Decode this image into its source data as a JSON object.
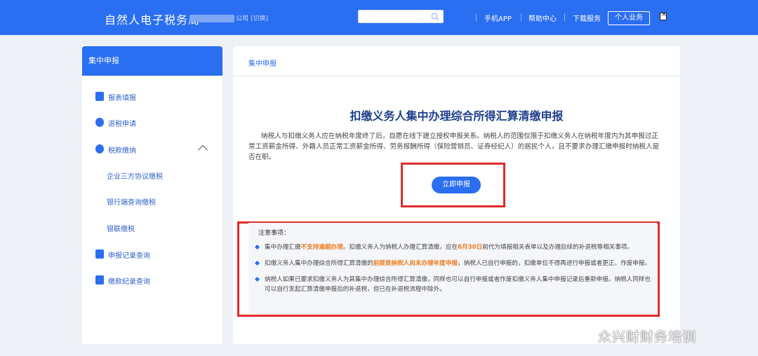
{
  "header": {
    "brand": "自然人电子税务局",
    "company_suffix": "公司",
    "switch_label": "[切换]",
    "nav": [
      "手机APP",
      "帮助中心",
      "下载服务"
    ],
    "personal_button": "个人业务"
  },
  "sidebar": {
    "heading": "集中申报",
    "items": [
      {
        "label": "报表填报",
        "icon": "form-icon"
      },
      {
        "label": "退税申请",
        "icon": "refund-icon"
      },
      {
        "label": "税款缴纳",
        "icon": "payment-icon"
      },
      {
        "label": "申报记录查询",
        "icon": "record-search-icon"
      },
      {
        "label": "缴款纪录查询",
        "icon": "payment-record-icon"
      }
    ],
    "subitems": [
      "企业三方协议缴税",
      "银行端查询缴税",
      "银联缴税"
    ]
  },
  "main": {
    "breadcrumb": "集中申报",
    "title": "扣缴义务人集中办理综合所得汇算清缴申报",
    "intro": "纳税人与扣缴义务人应在纳税年度终了后，自愿在线下建立授权申报关系。纳税人的范围仅限于扣缴义务人在纳税年度内为其申报过正常工资薪金所得、外籍人员正常工资薪金所得、劳务报酬所得（保险营销员、证券经纪人）的居民个人，且不要求办理汇缴申报时纳税人是否在职。",
    "apply_button": "立即申报",
    "notes_title": "注意事项：",
    "note1": {
      "a": "集中办理汇缴",
      "b": "不支持逾期办理",
      "c": "。扣缴义务人为纳税人办理汇算清缴，应在",
      "d": "6月30日",
      "e": "前代为填报相关表单以及办理后续的补退税等相关事项。"
    },
    "note2": {
      "a": "扣缴义务人集中办理综合所得汇算清缴的",
      "b": "前提是纳税人尚未办理年度申报",
      "c": "，纳税人已自行申报的，扣缴单位不得再进行申报或者更正、作废申报。"
    },
    "note3": "纳税人如果已要求扣缴义务人为其集中办理综合所得汇算清缴，同样也可以自行申报或者作废扣缴义务人集中申报记录后重新申报。纳税人同样也可以自行发起汇算清缴申报后的补退税，但已在补退税流程中除外。"
  },
  "watermark": "众兴财财务培训",
  "colors": {
    "primary": "#2a6ef1",
    "highlight": "#f07c1e",
    "annotation": "#e12b2b"
  }
}
